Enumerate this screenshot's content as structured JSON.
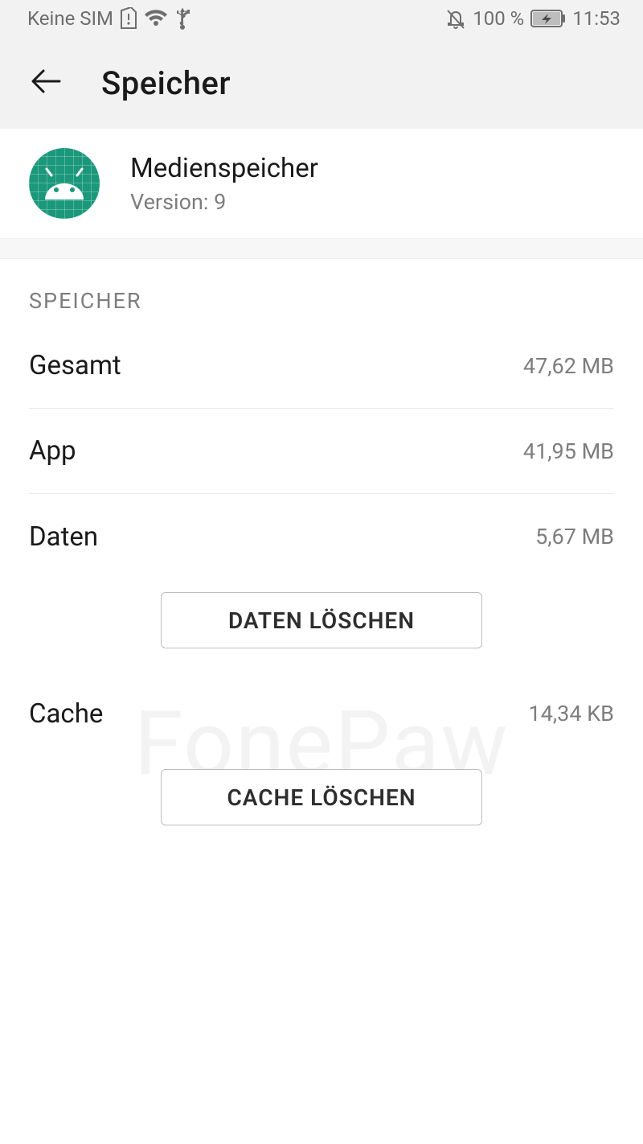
{
  "status": {
    "left_text": "Keine SIM",
    "battery_pct": "100 %",
    "time": "11:53"
  },
  "appbar": {
    "title": "Speicher"
  },
  "app": {
    "name": "Medienspeicher",
    "version_label": "Version: 9"
  },
  "section": {
    "header": "SPEICHER",
    "total": {
      "label": "Gesamt",
      "value": "47,62 MB"
    },
    "app": {
      "label": "App",
      "value": "41,95 MB"
    },
    "data": {
      "label": "Daten",
      "value": "5,67 MB"
    },
    "cache": {
      "label": "Cache",
      "value": "14,34 KB"
    }
  },
  "buttons": {
    "clear_data": "DATEN LÖSCHEN",
    "clear_cache": "CACHE LÖSCHEN"
  },
  "watermark": "FonePaw"
}
